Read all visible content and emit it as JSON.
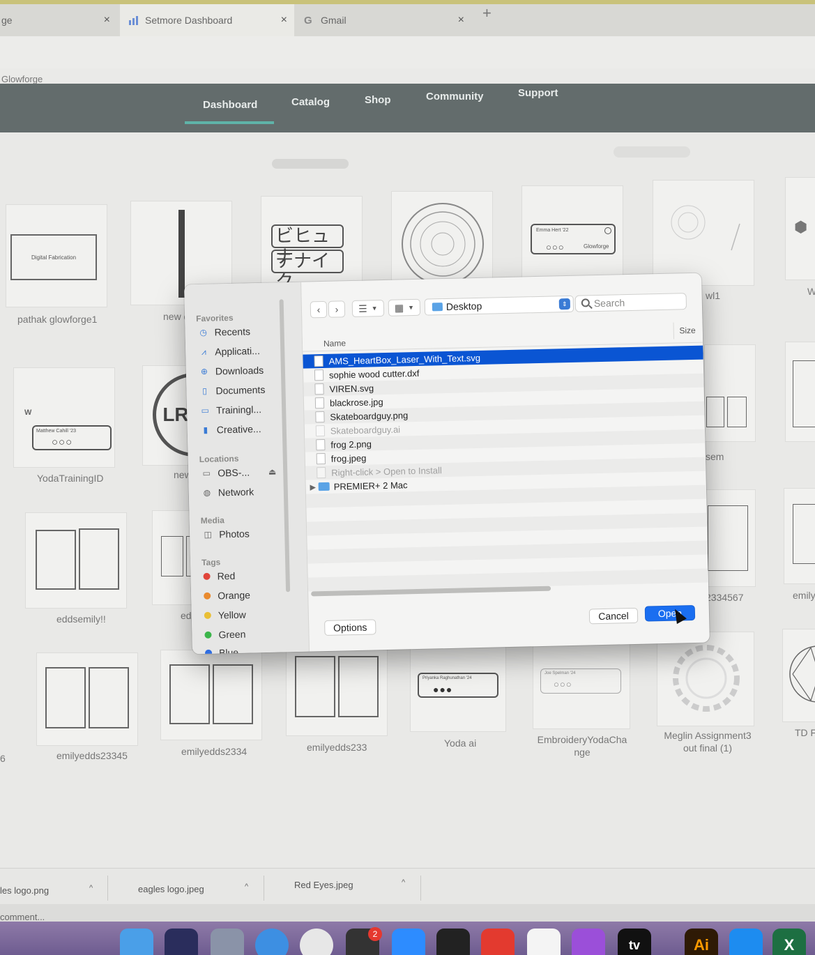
{
  "browser": {
    "tabs": [
      {
        "label": "ge",
        "close": "×"
      },
      {
        "label": "Setmore Dashboard",
        "close": "×"
      },
      {
        "label": "Gmail",
        "close": "×"
      }
    ],
    "new_tab": "+",
    "site_name": "Glowforge"
  },
  "nav": {
    "items": [
      "Dashboard",
      "Catalog",
      "Shop",
      "Community",
      "Support"
    ],
    "active": "Dashboard"
  },
  "designs": {
    "row1": [
      "pathak glowforge1",
      "new d",
      "",
      "",
      "",
      "wl1",
      "W"
    ],
    "row1_thumb_texts": {
      "digital_fabrication": "Digital Fabrication",
      "katakana_top": "ビヒュナ",
      "katakana_bottom": "テナイク",
      "emma_name": "Emma Hert '22",
      "emma_brand": "Glowforge"
    },
    "row2": [
      "YodaTrainingID",
      "new d",
      "sem"
    ],
    "row2_thumb_texts": {
      "matthew": "Matthew Cahill '23",
      "lr": "LR",
      "w": "W"
    },
    "row3": [
      "eddsemily!!",
      "eddse",
      "2334567",
      "emily"
    ],
    "row4": [
      "6",
      "emilyedds23345",
      "emilyedds2334",
      "emilyedds233",
      "Yoda ai",
      "EmbroideryYodaCha nge",
      "Meglin Assignment3 out final (1)",
      "TD F"
    ],
    "row4_thumb_texts": {
      "priyanka": "Priyanka Raghunathan '24",
      "joe": "Joe Spelman '24"
    }
  },
  "dialog": {
    "sidebar": {
      "favorites_heading": "Favorites",
      "favorites": [
        {
          "label": "Recents",
          "icon": "clock-icon"
        },
        {
          "label": "Applicati...",
          "icon": "applications-icon"
        },
        {
          "label": "Downloads",
          "icon": "download-icon"
        },
        {
          "label": "Documents",
          "icon": "document-icon"
        },
        {
          "label": "Trainingl...",
          "icon": "folder-icon"
        },
        {
          "label": "Creative...",
          "icon": "file-icon"
        }
      ],
      "locations_heading": "Locations",
      "locations": [
        {
          "label": "OBS-...",
          "icon": "drive-icon",
          "eject": "⏏"
        },
        {
          "label": "Network",
          "icon": "globe-icon"
        }
      ],
      "media_heading": "Media",
      "media": [
        {
          "label": "Photos",
          "icon": "camera-icon"
        }
      ],
      "tags_heading": "Tags",
      "tags": [
        {
          "label": "Red",
          "color": "#e0443a"
        },
        {
          "label": "Orange",
          "color": "#e98a2e"
        },
        {
          "label": "Yellow",
          "color": "#e9bf35"
        },
        {
          "label": "Green",
          "color": "#3bb54a"
        },
        {
          "label": "Blue",
          "color": "#2f6de0"
        }
      ]
    },
    "toolbar": {
      "back": "‹",
      "forward": "›",
      "list_view": "☰",
      "grid_view": "▦",
      "location": "Desktop",
      "search_placeholder": "Search"
    },
    "columns": {
      "name": "Name",
      "size": "Size"
    },
    "files": [
      {
        "name": "AMS_HeartBox_Laser_With_Text.svg",
        "selected": true,
        "dim": false,
        "type": "file"
      },
      {
        "name": "sophie wood cutter.dxf",
        "selected": false,
        "dim": false,
        "type": "file"
      },
      {
        "name": "VIREN.svg",
        "selected": false,
        "dim": false,
        "type": "file"
      },
      {
        "name": "blackrose.jpg",
        "selected": false,
        "dim": false,
        "type": "file"
      },
      {
        "name": "Skateboardguy.png",
        "selected": false,
        "dim": false,
        "type": "file"
      },
      {
        "name": "Skateboardguy.ai",
        "selected": false,
        "dim": true,
        "type": "file"
      },
      {
        "name": "frog 2.png",
        "selected": false,
        "dim": false,
        "type": "file"
      },
      {
        "name": "frog.jpeg",
        "selected": false,
        "dim": false,
        "type": "file"
      },
      {
        "name": "Right-click > Open to Install",
        "selected": false,
        "dim": true,
        "type": "file"
      },
      {
        "name": "PREMIER+ 2 Mac",
        "selected": false,
        "dim": false,
        "type": "folder"
      }
    ],
    "buttons": {
      "options": "Options",
      "cancel": "Cancel",
      "open": "Open"
    }
  },
  "downloads": [
    {
      "label": "les logo.png",
      "caret": "^"
    },
    {
      "label": "eagles logo.jpeg",
      "caret": "^"
    },
    {
      "label": "Red Eyes.jpeg",
      "caret": "^"
    }
  ],
  "status": {
    "text": "comment..."
  },
  "dock": {
    "badge": "2",
    "ai_label": "Ai",
    "tv_label": "tv",
    "excel_label": "X"
  },
  "colors": {
    "nav_bg": "#636c6c",
    "nav_accent": "#5fb3a8",
    "selection": "#0a55d3",
    "primary_button": "#1a6ef0"
  }
}
